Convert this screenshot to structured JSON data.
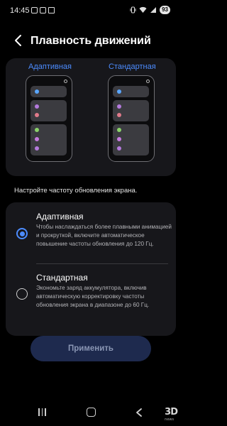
{
  "status_bar": {
    "time": "14:45",
    "battery": "93",
    "icons": [
      "screenshot-icon",
      "image-icon",
      "mail-icon",
      "vibrate-icon",
      "wifi-icon",
      "signal-icon"
    ]
  },
  "header": {
    "back_icon": "chevron-left-icon",
    "title": "Плавность движений"
  },
  "preview": {
    "adaptive_label": "Адаптивная",
    "standard_label": "Стандартная",
    "dot_colors": [
      "#5aa6ff",
      "#b47adc",
      "#e07a8a",
      "#8ad26a",
      "#c77ae0",
      "#b47adc"
    ]
  },
  "subtitle": "Настройте частоту обновления экрана.",
  "options": [
    {
      "title": "Адаптивная",
      "description": "Чтобы наслаждаться более плавными анимацией и прокруткой, включите автоматическое повышение частоты обновления до 120 Гц.",
      "selected": true
    },
    {
      "title": "Стандартная",
      "description": "Экономьте заряд аккумулятора, включив автоматическую корректировку частоты обновления экрана в диапазоне до 60 Гц.",
      "selected": false
    }
  ],
  "apply_button": "Применить",
  "nav": {
    "icons": [
      "recent-apps-icon",
      "home-icon",
      "back-icon"
    ],
    "watermark": "3D",
    "watermark_small": "news"
  },
  "colors": {
    "accent": "#4c8cff",
    "card": "#17171b",
    "button_bg": "#1e2a4e"
  }
}
